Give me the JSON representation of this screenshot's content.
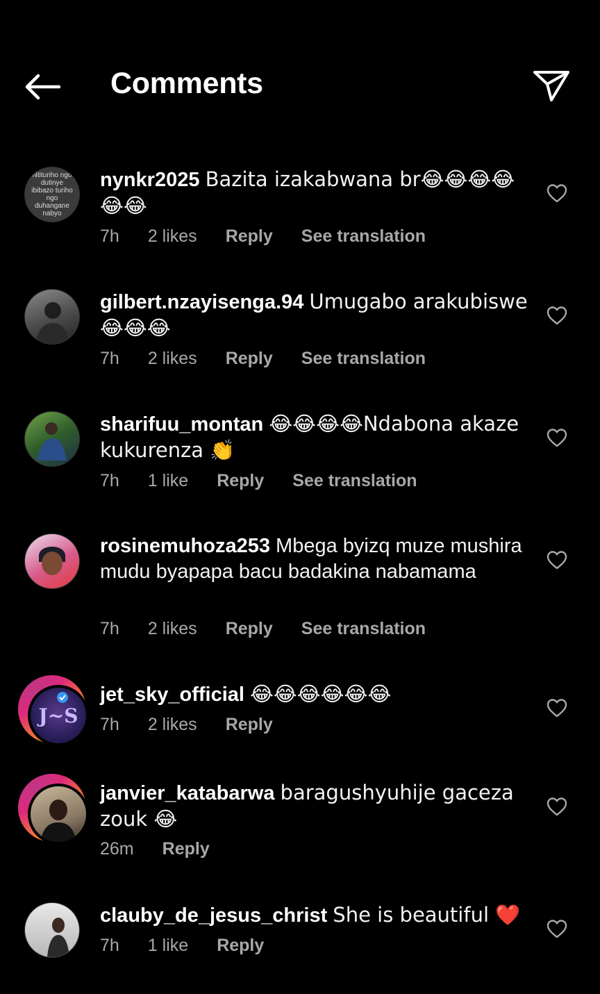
{
  "header": {
    "title": "Comments",
    "back_icon": "arrow-left-icon",
    "share_icon": "paper-plane-icon"
  },
  "comments": [
    {
      "username": "nynkr2025",
      "text": "Bazita izakabwana br😂😂😂😂😂😂",
      "time": "7h",
      "likes": "2 likes",
      "reply": "Reply",
      "translate": "See translation",
      "avatar_text": "Ntituriho ngo dutinye ibibazo turiho ngo duhangane nabyo"
    },
    {
      "username": "gilbert.nzayisenga.94",
      "text": "Umugabo arakubiswe 😂😂😂",
      "time": "7h",
      "likes": "2 likes",
      "reply": "Reply",
      "translate": "See translation"
    },
    {
      "username": "sharifuu_montan",
      "text": "😂😂😂😂Ndabona akaze kukurenza 👏",
      "time": "7h",
      "likes": "1 like",
      "reply": "Reply",
      "translate": "See translation"
    },
    {
      "username": "rosinemuhoza253",
      "text": "Mbega byizq muze mushira mudu byapapa bacu badakina nabamama",
      "time": "7h",
      "likes": "2 likes",
      "reply": "Reply",
      "translate": "See translation"
    },
    {
      "username": "jet_sky_official",
      "text": "😂😂😂😂😂😂",
      "time": "7h",
      "likes": "2 likes",
      "reply": "Reply"
    },
    {
      "username": "janvier_katabarwa",
      "text": "baragushyuhije gaceza zouk 😂",
      "time": "26m",
      "reply": "Reply"
    },
    {
      "username": "clauby_de_jesus_christ",
      "text": "She is beautiful ❤️",
      "time": "7h",
      "likes": "1 like",
      "reply": "Reply"
    }
  ],
  "colors": {
    "background": "#000000",
    "text": "#ffffff",
    "meta": "#a8a8a8",
    "story_ring_start": "#f58529",
    "story_ring_end": "#dd2a7b"
  }
}
